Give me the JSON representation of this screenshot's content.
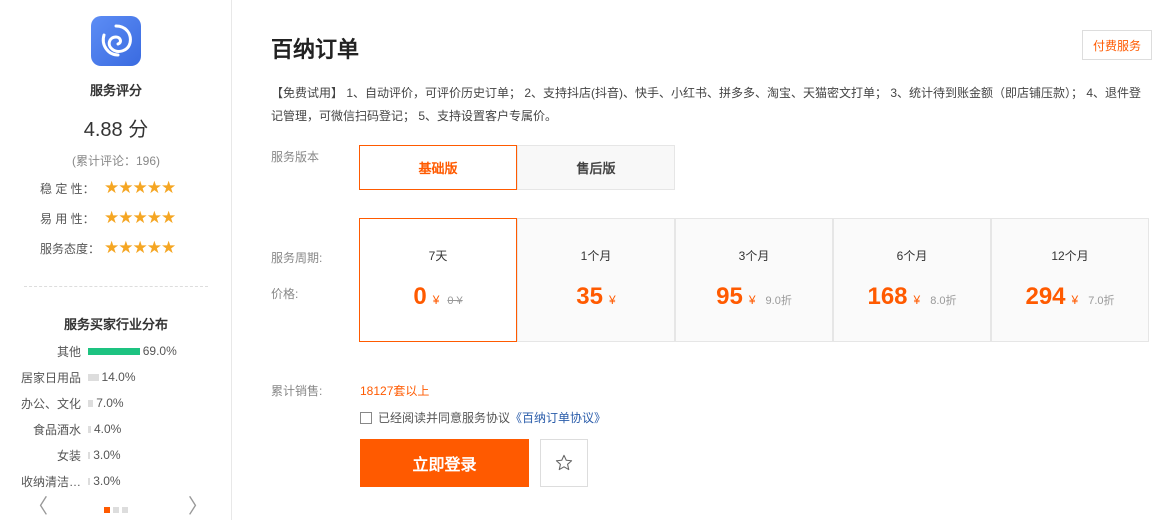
{
  "sidebar": {
    "logo_icon": "swirl-logo-icon",
    "rating_title": "服务评分",
    "rating_score": "4.88 分",
    "rating_count": "(累计评论：196)",
    "ratings": [
      {
        "label": "稳 定 性：",
        "stars": "★★★★★",
        "value": 5
      },
      {
        "label": "易 用 性：",
        "stars": "★★★★★",
        "value": 5
      },
      {
        "label": "服务态度：",
        "stars": "★★★★★",
        "value": 5
      }
    ],
    "distribution_title": "服务买家行业分布",
    "distribution": [
      {
        "label": "其他",
        "pct": "69.0%",
        "value": 69.0
      },
      {
        "label": "居家日用品",
        "pct": "14.0%",
        "value": 14.0
      },
      {
        "label": "办公、文化",
        "pct": "7.0%",
        "value": 7.0
      },
      {
        "label": "食品酒水",
        "pct": "4.0%",
        "value": 4.0
      },
      {
        "label": "女装",
        "pct": "3.0%",
        "value": 3.0
      },
      {
        "label": "收纳清洁…",
        "pct": "3.0%",
        "value": 3.0
      }
    ],
    "prev_arrow": "〈",
    "next_arrow": "〉",
    "page_dots": 3,
    "active_dot": 0
  },
  "main": {
    "title": "百纳订单",
    "paid_button": "付费服务",
    "description": "【免费试用】 1、自动评价，可评价历史订单； 2、支持抖店(抖音)、快手、小红书、拼多多、淘宝、天猫密文打单； 3、统计待到账金额（即店铺压款）； 4、退件登记管理，可微信扫码登记； 5、支持设置客户专属价。",
    "version_label": "服务版本",
    "versions": [
      {
        "label": "基础版",
        "selected": true
      },
      {
        "label": "售后版",
        "selected": false
      }
    ],
    "period_label": "服务周期:",
    "price_label": "价格:",
    "plans": [
      {
        "period": "7天",
        "price": "0",
        "yen": "¥",
        "original": "0 ¥",
        "discount": "",
        "selected": true
      },
      {
        "period": "1个月",
        "price": "35",
        "yen": "¥",
        "original": "",
        "discount": "",
        "selected": false
      },
      {
        "period": "3个月",
        "price": "95",
        "yen": "¥",
        "original": "",
        "discount": "9.0折",
        "selected": false
      },
      {
        "period": "6个月",
        "price": "168",
        "yen": "¥",
        "original": "",
        "discount": "8.0折",
        "selected": false
      },
      {
        "period": "12个月",
        "price": "294",
        "yen": "¥",
        "original": "",
        "discount": "7.0折",
        "selected": false
      }
    ],
    "sales_label": "累计销售:",
    "sales_value": "18127套以上",
    "agree_text": "已经阅读并同意服务协议",
    "agree_link": "《百纳订单协议》",
    "login_button": "立即登录",
    "favorite_icon": "star-outline-icon"
  },
  "colors": {
    "accent": "#ff5a00",
    "star": "#f5a623",
    "bar_top": "#1dc381",
    "link": "#2a5caa"
  }
}
